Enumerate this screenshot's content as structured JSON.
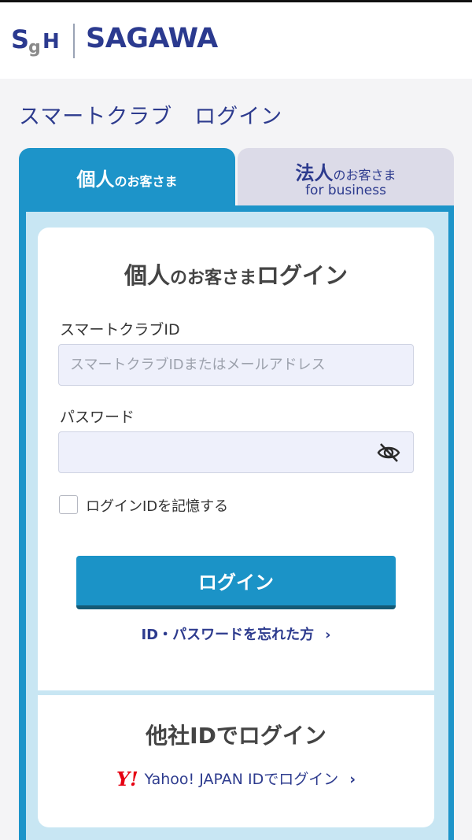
{
  "header": {
    "brand_mark": "SgH",
    "brand_name": "SAGAWA"
  },
  "page": {
    "title": "スマートクラブ　ログイン"
  },
  "tabs": {
    "personal": {
      "main": "個人",
      "suffix": "のお客さま"
    },
    "business": {
      "main": "法人",
      "suffix": "のお客さま",
      "sub": "for business"
    }
  },
  "login": {
    "heading_main": "個人",
    "heading_mid": "のお客さま",
    "heading_end": "ログイン",
    "id_label": "スマートクラブID",
    "id_placeholder": "スマートクラブIDまたはメールアドレス",
    "password_label": "パスワード",
    "remember_label": "ログインIDを記憶する",
    "submit_label": "ログイン",
    "forgot_label": "ID・パスワードを忘れた方"
  },
  "other": {
    "heading": "他社IDでログイン",
    "yahoo_logo": "Y!",
    "yahoo_label": "Yahoo! JAPAN IDでログイン"
  },
  "colors": {
    "primary": "#1d94c9",
    "navy": "#2d3b8e",
    "yahoo_red": "#e60012"
  },
  "icons": {
    "eye": "eye-slash-icon",
    "chevron": "chevron-right-icon"
  }
}
